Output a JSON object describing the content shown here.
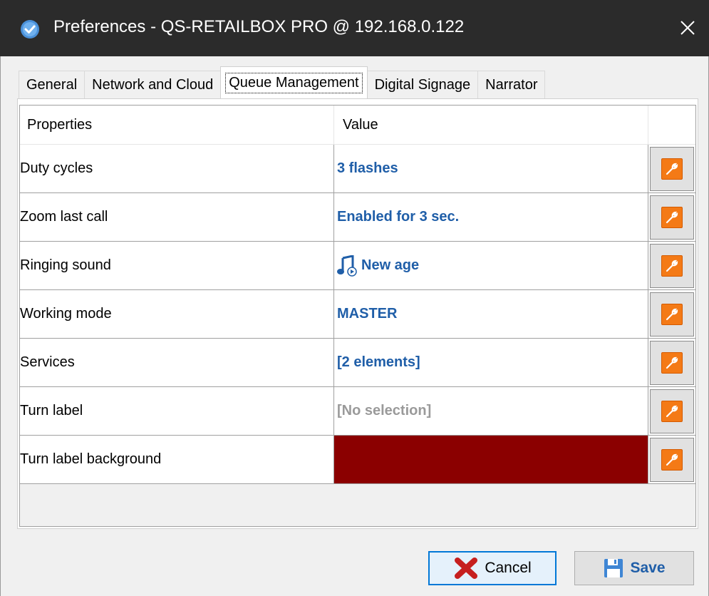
{
  "window": {
    "title": "Preferences - QS-RETAILBOX PRO @ 192.168.0.122",
    "close_glyph": "✕"
  },
  "tabs": [
    {
      "label": "General",
      "active": false
    },
    {
      "label": "Network and Cloud",
      "active": false
    },
    {
      "label": "Queue Management",
      "active": true
    },
    {
      "label": "Digital Signage",
      "active": false
    },
    {
      "label": "Narrator",
      "active": false
    }
  ],
  "grid": {
    "headers": {
      "properties": "Properties",
      "value": "Value"
    },
    "rows": [
      {
        "property": "Duty cycles",
        "value": "3 flashes"
      },
      {
        "property": "Zoom last call",
        "value": "Enabled for 3 sec."
      },
      {
        "property": "Ringing sound",
        "value": "New age",
        "icon": "music-note-icon"
      },
      {
        "property": "Working mode",
        "value": "MASTER"
      },
      {
        "property": "Services",
        "value": "[2 elements]"
      },
      {
        "property": "Turn label",
        "value": "[No selection]"
      },
      {
        "property": "Turn label background",
        "value": "",
        "color": "#8b0000"
      }
    ]
  },
  "buttons": {
    "cancel": "Cancel",
    "save": "Save"
  },
  "colors": {
    "titlebar": "#2b2b2b",
    "value_text": "#1f5ea8",
    "edit_button": "#f47a16",
    "swatch": "#8b0000"
  }
}
